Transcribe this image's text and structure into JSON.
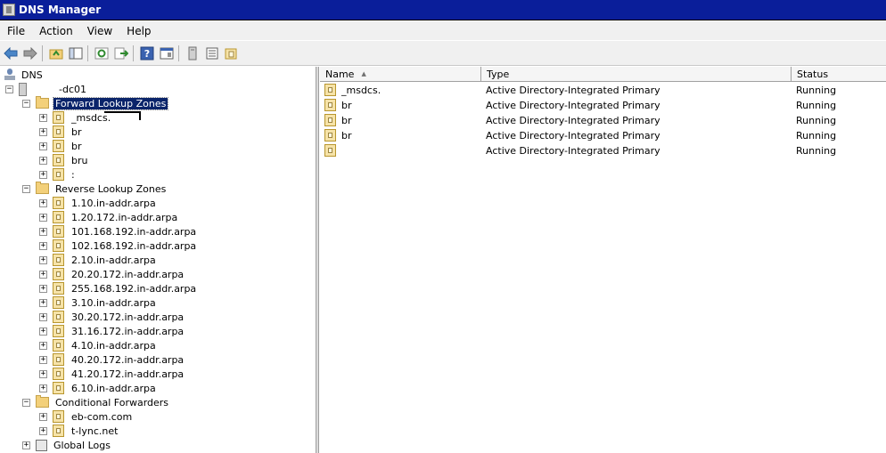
{
  "window": {
    "title": "DNS Manager"
  },
  "menu": [
    "File",
    "Action",
    "View",
    "Help"
  ],
  "toolbar": {
    "icons": [
      "back-arrow-icon",
      "forward-arrow-icon",
      "up-folder-icon",
      "show-hide-tree-icon",
      "refresh-icon",
      "export-list-icon",
      "help-icon",
      "properties-icon",
      "server-icon",
      "list-icon",
      "zone-icon"
    ]
  },
  "tree": {
    "root": "DNS",
    "server": "-dc01",
    "forward": {
      "label": "Forward Lookup Zones",
      "children": [
        "_msdcs.",
        "br",
        "br",
        "bru",
        ":"
      ]
    },
    "reverse": {
      "label": "Reverse Lookup Zones",
      "children": [
        "1.10.in-addr.arpa",
        "1.20.172.in-addr.arpa",
        "101.168.192.in-addr.arpa",
        "102.168.192.in-addr.arpa",
        "2.10.in-addr.arpa",
        "20.20.172.in-addr.arpa",
        "255.168.192.in-addr.arpa",
        "3.10.in-addr.arpa",
        "30.20.172.in-addr.arpa",
        "31.16.172.in-addr.arpa",
        "4.10.in-addr.arpa",
        "40.20.172.in-addr.arpa",
        "41.20.172.in-addr.arpa",
        "6.10.in-addr.arpa"
      ]
    },
    "conditional": {
      "label": "Conditional Forwarders",
      "children": [
        "eb-com.com",
        "t-lync.net"
      ]
    },
    "logs": "Global Logs"
  },
  "list": {
    "columns": [
      "Name",
      "Type",
      "Status"
    ],
    "rows": [
      [
        "_msdcs.",
        "Active Directory-Integrated Primary",
        "Running"
      ],
      [
        "br",
        "Active Directory-Integrated Primary",
        "Running"
      ],
      [
        "br",
        "Active Directory-Integrated Primary",
        "Running"
      ],
      [
        "br",
        "Active Directory-Integrated Primary",
        "Running"
      ],
      [
        "",
        "Active Directory-Integrated Primary",
        "Running"
      ]
    ]
  },
  "colors": {
    "titlebar": "#0a1e9a",
    "selection": "#0a246a"
  }
}
